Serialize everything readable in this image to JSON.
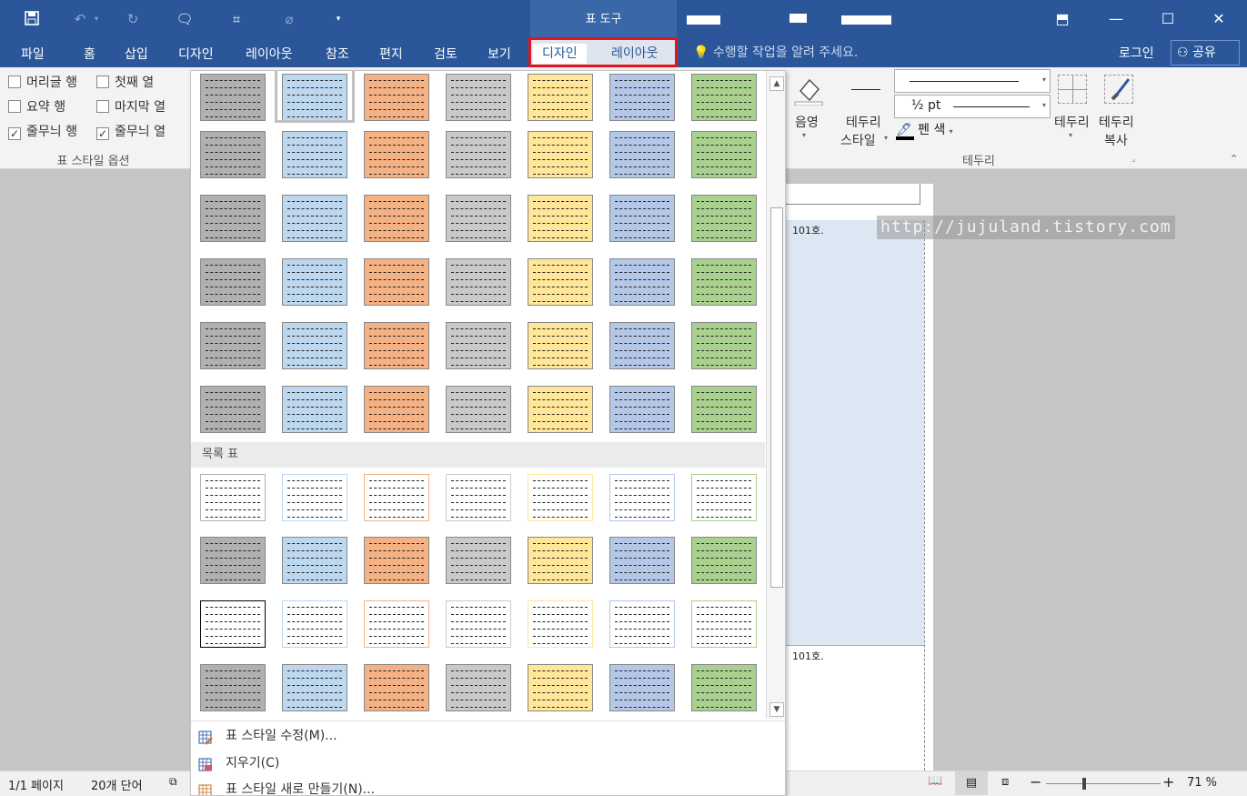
{
  "title_bar": {
    "context_title": "표 도구",
    "buttons": [
      "restore-ribbon",
      "minimize",
      "maximize",
      "close"
    ]
  },
  "tabs": [
    "파일",
    "홈",
    "삽입",
    "디자인",
    "레이아웃",
    "참조",
    "편지",
    "검토",
    "보기"
  ],
  "context_tabs": [
    "디자인",
    "레이아웃"
  ],
  "tell_me": "수행할 작업을 알려 주세요.",
  "login": "로그인",
  "share": "공유",
  "style_options": {
    "items": [
      {
        "label": "머리글 행",
        "checked": false
      },
      {
        "label": "첫째 열",
        "checked": false
      },
      {
        "label": "요약 행",
        "checked": false
      },
      {
        "label": "마지막 열",
        "checked": false
      },
      {
        "label": "줄무늬 행",
        "checked": true
      },
      {
        "label": "줄무늬 열",
        "checked": true
      }
    ],
    "group_label": "표 스타일 옵션"
  },
  "ribbon_right": {
    "shading_label": "음영",
    "border_style_label1": "테두리",
    "border_style_label2": "스타일",
    "weight_value": "½ pt",
    "pen_color_label": "펜 색",
    "borders_label": "테두리",
    "painter_label1": "테두리",
    "painter_label2": "복사",
    "group_label": "테두리"
  },
  "gallery": {
    "section_label": "목록 표",
    "colors": [
      "#b0b0b0",
      "#bdd7ee",
      "#f4b183",
      "#c9c9c9",
      "#ffe699",
      "#b4c7e7",
      "#a9d08e"
    ],
    "menu": [
      {
        "label": "표 스타일 수정(M)...",
        "icon": "table-edit-icon"
      },
      {
        "label": "지우기(C)",
        "icon": "eraser-icon"
      },
      {
        "label": "표 스타일 새로 만들기(N)...",
        "icon": "table-new-icon"
      }
    ]
  },
  "document": {
    "cell1": "101호.",
    "cell2": "101호.",
    "watermark": "http://jujuland.tistory.com"
  },
  "status_bar": {
    "page": "1/1 페이지",
    "words": "20개 단어",
    "zoom": "71 %"
  }
}
